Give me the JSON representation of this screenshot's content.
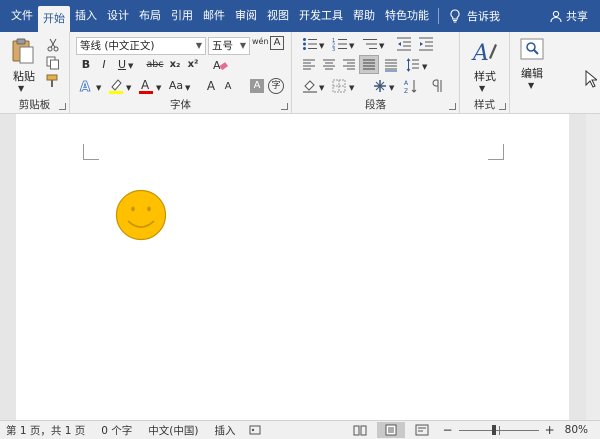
{
  "tabs": [
    "文件",
    "开始",
    "插入",
    "设计",
    "布局",
    "引用",
    "邮件",
    "审阅",
    "视图",
    "开发工具",
    "帮助",
    "特色功能"
  ],
  "active_tab": "开始",
  "tell_me": "告诉我",
  "share": "共享",
  "clipboard": {
    "paste_label": "粘贴",
    "group_label": "剪贴板"
  },
  "font": {
    "font_name": "等线 (中文正文)",
    "font_size": "五号",
    "group_label": "字体",
    "bold": "B",
    "italic": "I",
    "underline": "U",
    "strike": "abc",
    "subscript": "x₂",
    "superscript": "x²",
    "font_color_a": "A",
    "change_case": "Aa",
    "grow": "A",
    "shrink": "A",
    "pinyin": "wén",
    "border": "A",
    "shading": "A",
    "enclose": "字"
  },
  "paragraph": {
    "group_label": "段落"
  },
  "styles": {
    "label": "样式",
    "group_label": "样式"
  },
  "editing": {
    "label": "编辑"
  },
  "status": {
    "page": "第 1 页，共 1 页",
    "words": "0 个字",
    "language": "中文(中国)",
    "mode": "插入",
    "zoom": "80%"
  },
  "colors": {
    "brand": "#2b579a",
    "highlight": "#ffff00",
    "font_red": "#e00000",
    "smiley": "#ffc000",
    "smiley_stroke": "#c89400"
  }
}
